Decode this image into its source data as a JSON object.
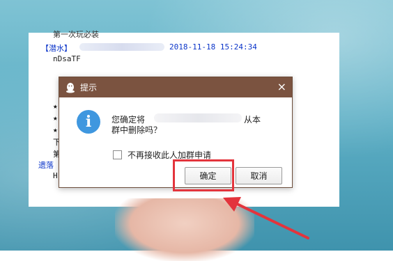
{
  "chat": {
    "cut_line": "第一次玩必装",
    "header_tag": "【潜水】",
    "timestamp": "2018-11-18 15:24:34",
    "message": "nDsaTF",
    "side_fragments": [
      "★",
      "★",
      "★",
      "下",
      "第"
    ],
    "blue_fragment": "遗落",
    "last_fragment": "H"
  },
  "dialog": {
    "title": "提示",
    "close_symbol": "×",
    "info_symbol": "i",
    "question_prefix": "您确定将",
    "question_suffix": "从本",
    "question_line2": "群中删除吗？",
    "checkbox_label": "不再接收此人加群申请",
    "ok_label": "确定",
    "cancel_label": "取消"
  },
  "colors": {
    "title_bar": "#7b5340",
    "info_icon": "#3f97df",
    "highlight": "#e3343c",
    "chat_blue": "#0b35c9"
  },
  "icons": {
    "title_icon": "qq-penguin-icon",
    "info": "info-icon",
    "close": "close-icon"
  }
}
